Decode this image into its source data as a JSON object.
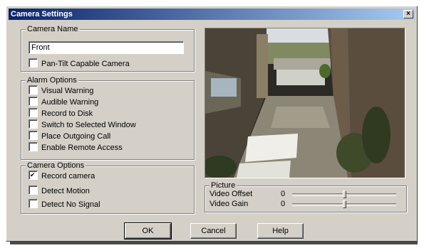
{
  "window": {
    "title": "Camera Settings",
    "close_glyph": "×"
  },
  "camera_name": {
    "legend": "Camera Name",
    "value": "Front",
    "pantilt_label": "Pan-Tilt Capable Camera",
    "pantilt_checked": false
  },
  "alarm_options": {
    "legend": "Alarm Options",
    "items": [
      {
        "label": "Visual Warning",
        "checked": false
      },
      {
        "label": "Audible Warning",
        "checked": false
      },
      {
        "label": "Record to Disk",
        "checked": false
      },
      {
        "label": "Switch to Selected Window",
        "checked": false
      },
      {
        "label": "Place Outgoing Call",
        "checked": false
      },
      {
        "label": "Enable Remote Access",
        "checked": false
      }
    ]
  },
  "camera_options": {
    "legend": "Camera Options",
    "items": [
      {
        "label": "Record camera",
        "checked": true
      },
      {
        "label": "Detect Motion",
        "checked": false
      },
      {
        "label": "Detect No Signal",
        "checked": false
      }
    ]
  },
  "picture": {
    "legend": "Picture",
    "sliders": [
      {
        "label": "Video Offset",
        "value": "0",
        "position": 0.5
      },
      {
        "label": "Video Gain",
        "value": "0",
        "position": 0.5
      }
    ]
  },
  "buttons": {
    "ok": "OK",
    "cancel": "Cancel",
    "help": "Help"
  }
}
